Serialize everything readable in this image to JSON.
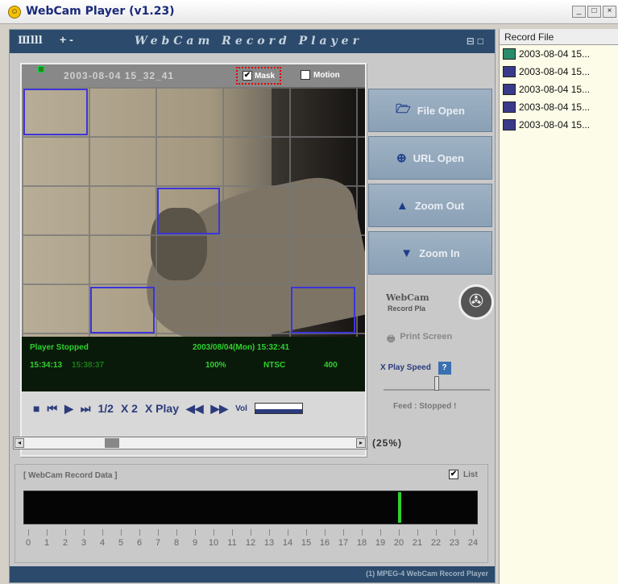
{
  "app": {
    "title": "WebCam Player (v1.23)"
  },
  "window_controls": {
    "minimize": "_",
    "maximize": "□",
    "close": "×"
  },
  "header": {
    "left_label": "Ⅲlll",
    "plus_label": "+ -",
    "title": "WebCam Record Player",
    "icons": "⊟□"
  },
  "video": {
    "timestamp": "2003-08-04 15_32_41",
    "mask_label": "Mask",
    "mask_checked": "✔",
    "motion_label": "Motion",
    "motion_checked": ""
  },
  "status": {
    "state": "Player Stopped",
    "datetime": "2003/08/04(Mon) 15:32:41",
    "time_current": "15:34:13",
    "time_total": "15:38:37",
    "zoom": "100%",
    "format": "NTSC",
    "volume": "400"
  },
  "controls": {
    "stop": "■",
    "prev": "⏮",
    "play": "▶",
    "next": "⏭",
    "half": "1/2",
    "double": "X 2",
    "xplay": "X Play",
    "rewind": "◀◀",
    "forward": "▶▶",
    "vol": "Vol"
  },
  "side_buttons": [
    {
      "label": "File Open",
      "icon": "folder-icon"
    },
    {
      "label": "URL Open",
      "icon": "url-icon"
    },
    {
      "label": "Zoom Out",
      "icon": "triangle-up-icon"
    },
    {
      "label": "Zoom In",
      "icon": "triangle-down-icon"
    }
  ],
  "logo": {
    "line1": "WebCam",
    "line2": "Record Pla"
  },
  "print_screen": "Print Screen",
  "speed": {
    "label": "X Play Speed",
    "help": "?",
    "feed": "Feed : Stopped !",
    "value_fraction": 0.5
  },
  "position": {
    "percent": "(25%)",
    "fraction": 0.25
  },
  "record_data": {
    "title": "[ WebCam Record Data ]",
    "list_label": "List",
    "list_checked": "✔",
    "ticks": [
      "0",
      "1",
      "2",
      "3",
      "4",
      "5",
      "6",
      "7",
      "8",
      "9",
      "10",
      "11",
      "12",
      "13",
      "14",
      "15",
      "16",
      "17",
      "18",
      "19",
      "20",
      "21",
      "22",
      "23",
      "24"
    ],
    "marker_hour": 20
  },
  "footer": "(1) MPEG-4 WebCam Record Player",
  "record_file": {
    "header": "Record File",
    "items": [
      "2003-08-04 15...",
      "2003-08-04 15...",
      "2003-08-04 15...",
      "2003-08-04 15...",
      "2003-08-04 15..."
    ]
  }
}
